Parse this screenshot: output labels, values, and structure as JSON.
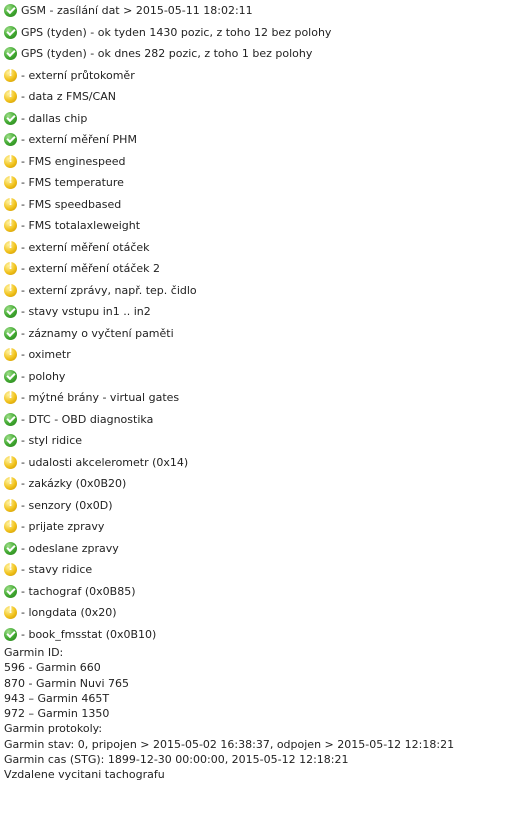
{
  "status_items": [
    {
      "status": "ok",
      "icon": "green-check-icon",
      "text": "GSM - zasílání dat > 2015-05-11 18:02:11"
    },
    {
      "status": "ok",
      "icon": "green-check-icon",
      "text": "GPS (tyden) - ok tyden 1430 pozic, z toho 12 bez polohy"
    },
    {
      "status": "ok",
      "icon": "green-check-icon",
      "text": "GPS (tyden) - ok dnes 282 pozic, z toho 1 bez polohy"
    },
    {
      "status": "warn",
      "icon": "yellow-warning-icon",
      "text": "- externí průtokoměr"
    },
    {
      "status": "warn",
      "icon": "yellow-warning-icon",
      "text": "- data z FMS/CAN"
    },
    {
      "status": "ok",
      "icon": "green-check-icon",
      "text": "- dallas chip"
    },
    {
      "status": "ok",
      "icon": "green-check-icon",
      "text": "- externí měření PHM"
    },
    {
      "status": "warn",
      "icon": "yellow-warning-icon",
      "text": "- FMS enginespeed"
    },
    {
      "status": "warn",
      "icon": "yellow-warning-icon",
      "text": "- FMS temperature"
    },
    {
      "status": "warn",
      "icon": "yellow-warning-icon",
      "text": "- FMS speedbased"
    },
    {
      "status": "warn",
      "icon": "yellow-warning-icon",
      "text": "- FMS totalaxleweight"
    },
    {
      "status": "warn",
      "icon": "yellow-warning-icon",
      "text": "- externí měření otáček"
    },
    {
      "status": "warn",
      "icon": "yellow-warning-icon",
      "text": "- externí měření otáček 2"
    },
    {
      "status": "warn",
      "icon": "yellow-warning-icon",
      "text": "- externí zprávy, např. tep. čidlo"
    },
    {
      "status": "ok",
      "icon": "green-check-icon",
      "text": "- stavy vstupu in1 .. in2"
    },
    {
      "status": "ok",
      "icon": "green-check-icon",
      "text": "- záznamy o vyčtení paměti"
    },
    {
      "status": "warn",
      "icon": "yellow-warning-icon",
      "text": "- oximetr"
    },
    {
      "status": "ok",
      "icon": "green-check-icon",
      "text": "- polohy"
    },
    {
      "status": "warn",
      "icon": "yellow-warning-icon",
      "text": "- mýtné brány - virtual gates"
    },
    {
      "status": "ok",
      "icon": "green-check-icon",
      "text": "- DTC - OBD diagnostika"
    },
    {
      "status": "ok",
      "icon": "green-check-icon",
      "text": "- styl ridice"
    },
    {
      "status": "warn",
      "icon": "yellow-warning-icon",
      "text": "- udalosti akcelerometr (0x14)"
    },
    {
      "status": "warn",
      "icon": "yellow-warning-icon",
      "text": "- zakázky (0x0B20)"
    },
    {
      "status": "warn",
      "icon": "yellow-warning-icon",
      "text": "- senzory (0x0D)"
    },
    {
      "status": "warn",
      "icon": "yellow-warning-icon",
      "text": "- prijate zpravy"
    },
    {
      "status": "ok",
      "icon": "green-check-icon",
      "text": "- odeslane zpravy"
    },
    {
      "status": "warn",
      "icon": "yellow-warning-icon",
      "text": "- stavy ridice"
    },
    {
      "status": "ok",
      "icon": "green-check-icon",
      "text": "- tachograf (0x0B85)"
    },
    {
      "status": "warn",
      "icon": "yellow-warning-icon",
      "text": "- longdata (0x20)"
    },
    {
      "status": "ok",
      "icon": "green-check-icon",
      "text": "- book_fmsstat (0x0B10)"
    }
  ],
  "garmin": {
    "id_heading": "Garmin ID:",
    "devices": [
      "596 - Garmin 660",
      "870 - Garmin Nuvi 765",
      "943 – Garmin 465T",
      "972 – Garmin 1350"
    ],
    "protocols_heading": "Garmin protokoly:",
    "state_line": "Garmin stav: 0, pripojen > 2015-05-02 16:38:37, odpojen > 2015-05-12 12:18:21",
    "time_line": "Garmin cas (STG): 1899-12-30 00:00:00, 2015-05-12 12:18:21",
    "remote_line": "Vzdalene vycitani tachografu"
  },
  "colors": {
    "ok": "#3fa72f",
    "warn": "#f1c21b",
    "text": "#222222"
  }
}
